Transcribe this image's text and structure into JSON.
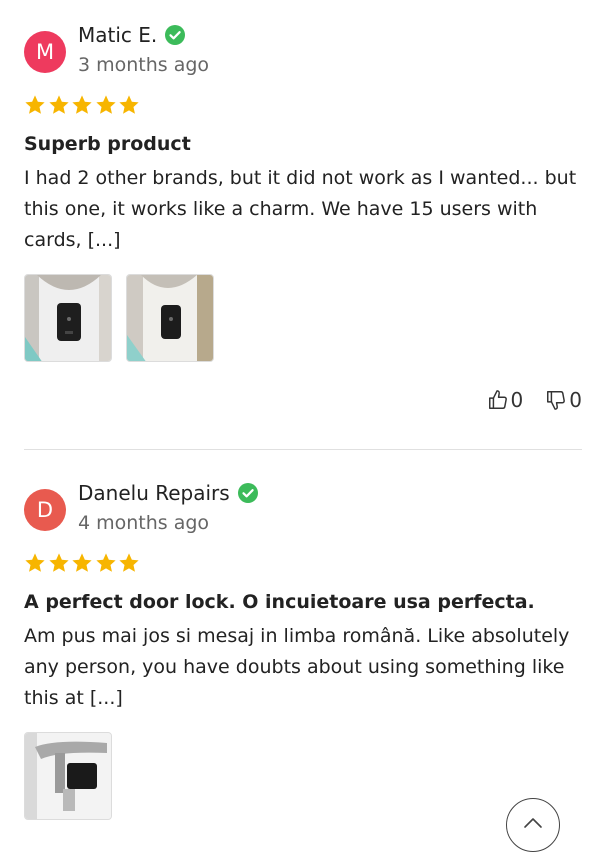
{
  "colors": {
    "avatar_1": "#ee3a5e",
    "avatar_2": "#e85a4f",
    "star": "#f7b500",
    "verified": "#3cbb5a"
  },
  "reviews": [
    {
      "initial": "M",
      "name": "Matic E.",
      "verified": true,
      "time": "3 months ago",
      "rating": 5,
      "title": "Superb product",
      "body": "I had 2 other brands, but it did not work as I wanted... but this one, it works like a charm. We have 15 users with cards, [...]",
      "photo_count": 2,
      "likes": "0",
      "dislikes": "0"
    },
    {
      "initial": "D",
      "name": "Danelu Repairs",
      "verified": true,
      "time": "4 months ago",
      "rating": 5,
      "title": "A perfect door lock. O incuietoare usa perfecta.",
      "body": "Am pus mai jos si mesaj in limba română. Like absolutely any person, you have doubts about using something like this at [...]",
      "photo_count": 1
    }
  ],
  "icons": {
    "verified": "check-circle-icon",
    "star": "star-icon",
    "like": "thumbs-up-icon",
    "dislike": "thumbs-down-icon",
    "scroll_top": "chevron-up-icon"
  }
}
